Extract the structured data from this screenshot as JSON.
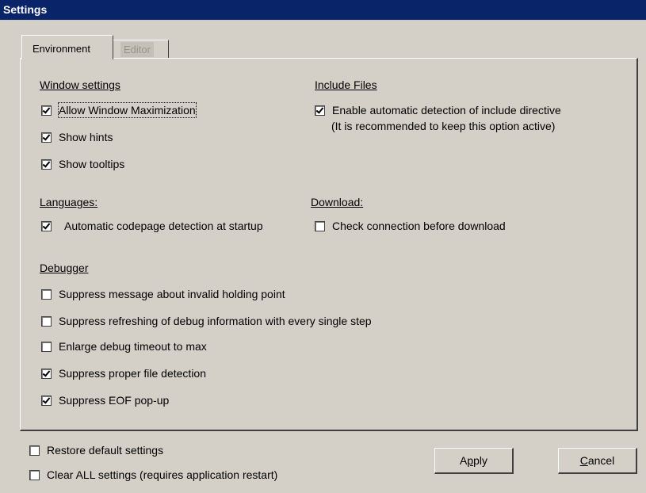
{
  "window": {
    "title": "Settings"
  },
  "tabs": {
    "environment": "Environment",
    "editor": "Editor"
  },
  "window_settings": {
    "heading": "Window settings",
    "allow_max": "Allow Window Maximization",
    "hints": "Show hints",
    "tooltips": "Show tooltips"
  },
  "include_files": {
    "heading": "Include Files",
    "auto_detect": "Enable automatic detection of include directive",
    "note": "(It is recommended to keep this option active)"
  },
  "languages": {
    "heading": "Languages:",
    "codepage": "Automatic codepage detection at startup"
  },
  "download": {
    "heading": "Download:",
    "check_conn": "Check connection before download"
  },
  "debugger": {
    "heading": "Debugger",
    "opt1": "Suppress message about invalid holding point",
    "opt2": "Suppress refreshing of debug information with every single step",
    "opt3": "Enlarge debug timeout to max",
    "opt4": "Suppress proper file detection",
    "opt5": "Suppress EOF pop-up"
  },
  "footer": {
    "restore": "Restore default settings",
    "clear": "Clear ALL settings (requires application restart)",
    "apply_pre": "A",
    "apply_ul": "p",
    "apply_post": "ply",
    "cancel_ul": "C",
    "cancel_post": "ancel"
  }
}
